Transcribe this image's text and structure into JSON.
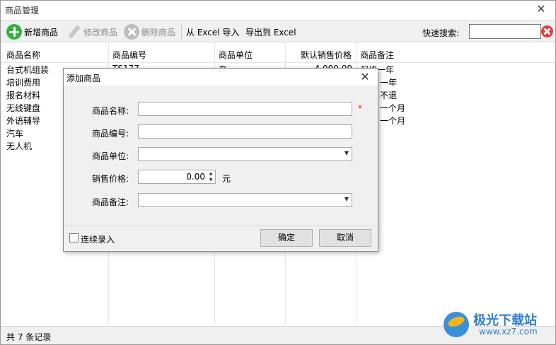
{
  "window": {
    "title": "商品管理"
  },
  "toolbar": {
    "add_label": "新增商品",
    "edit_label": "修改商品",
    "delete_label": "删除商品",
    "import_label": "从 Excel 导入",
    "export_label": "导出到 Excel",
    "search_label": "快速搜索:",
    "search_value": ""
  },
  "table": {
    "headers": [
      "商品名称",
      "商品编号",
      "商品单位",
      "默认销售价格",
      "商品备注"
    ],
    "rows": [
      {
        "name": "台式机组装",
        "code": "TS177",
        "unit": "套",
        "price": "4,000.00",
        "remark": "保修一年"
      },
      {
        "name": "培训费用",
        "code": "",
        "unit": "",
        "price": "",
        "remark": "一年"
      },
      {
        "name": "报名材料",
        "code": "",
        "unit": "",
        "price": "",
        "remark": "不退"
      },
      {
        "name": "无线键盘",
        "code": "",
        "unit": "",
        "price": "",
        "remark": "一个月"
      },
      {
        "name": "外语辅导",
        "code": "",
        "unit": "",
        "price": "",
        "remark": "一个月"
      },
      {
        "name": "汽车",
        "code": "",
        "unit": "",
        "price": "",
        "remark": ""
      },
      {
        "name": "无人机",
        "code": "",
        "unit": "",
        "price": "",
        "remark": ""
      }
    ]
  },
  "status": {
    "record_count": "共 7 条记录"
  },
  "dialog": {
    "title": "添加商品",
    "name_label": "商品名称:",
    "code_label": "商品编号:",
    "unit_label": "商品单位:",
    "price_label": "销售价格:",
    "remark_label": "商品备注:",
    "required_mark": "*",
    "price_value": "0.00",
    "price_unit": "元",
    "continuous_label": "连续录入",
    "ok_label": "确定",
    "cancel_label": "取消"
  },
  "watermark": {
    "brand": "极光下载站",
    "url": "www.xz7.com"
  }
}
